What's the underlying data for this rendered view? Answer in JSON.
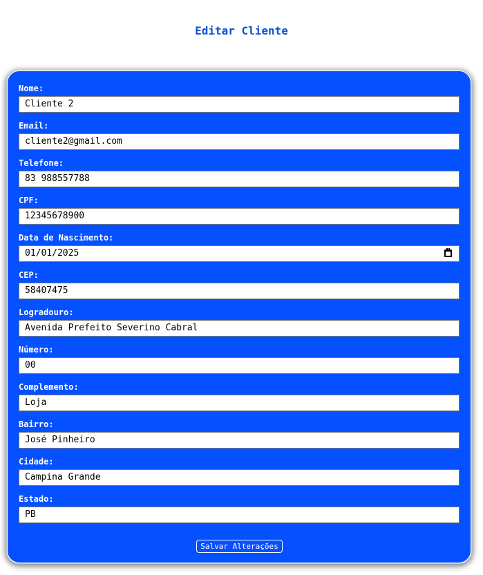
{
  "page": {
    "title": "Editar Cliente"
  },
  "colors": {
    "card_background": "#0550ff",
    "title": "#0d52d6",
    "label": "#ffffff"
  },
  "form": {
    "fields": [
      {
        "label": "Nome:",
        "value": "Cliente 2"
      },
      {
        "label": "Email:",
        "value": "cliente2@gmail.com"
      },
      {
        "label": "Telefone:",
        "value": "83 988557788"
      },
      {
        "label": "CPF:",
        "value": "12345678900"
      },
      {
        "label": "Data de Nascimento:",
        "value": "01/01/2025"
      },
      {
        "label": "CEP:",
        "value": "58407475"
      },
      {
        "label": "Logradouro:",
        "value": "Avenida Prefeito Severino Cabral"
      },
      {
        "label": "Número:",
        "value": "00"
      },
      {
        "label": "Complemento:",
        "value": "Loja"
      },
      {
        "label": "Bairro:",
        "value": "José Pinheiro"
      },
      {
        "label": "Cidade:",
        "value": "Campina Grande"
      },
      {
        "label": "Estado:",
        "value": "PB"
      }
    ],
    "date_icon": "calendar-icon",
    "submit_label": "Salvar Alterações"
  }
}
